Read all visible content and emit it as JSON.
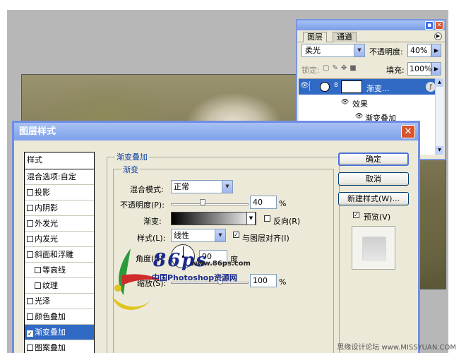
{
  "layers_panel": {
    "tabs": [
      "图层",
      "通道"
    ],
    "blend_mode": "柔光",
    "opacity_label": "不透明度:",
    "opacity_value": "40%",
    "lock_label": "锁定:",
    "fill_label": "填充:",
    "fill_value": "100%",
    "layer_name": "渐变...",
    "effects_label": "效果",
    "effect_item": "渐变叠加"
  },
  "dialog": {
    "title": "图层样式",
    "styles_header": "样式",
    "blend_options": "混合选项:自定",
    "style_items": [
      {
        "label": "投影",
        "checked": false,
        "indent": false,
        "selected": false
      },
      {
        "label": "内阴影",
        "checked": false,
        "indent": false,
        "selected": false
      },
      {
        "label": "外发光",
        "checked": false,
        "indent": false,
        "selected": false
      },
      {
        "label": "内发光",
        "checked": false,
        "indent": false,
        "selected": false
      },
      {
        "label": "斜面和浮雕",
        "checked": false,
        "indent": false,
        "selected": false
      },
      {
        "label": "等高线",
        "checked": false,
        "indent": true,
        "selected": false
      },
      {
        "label": "纹理",
        "checked": false,
        "indent": true,
        "selected": false
      },
      {
        "label": "光泽",
        "checked": false,
        "indent": false,
        "selected": false
      },
      {
        "label": "颜色叠加",
        "checked": false,
        "indent": false,
        "selected": false
      },
      {
        "label": "渐变叠加",
        "checked": true,
        "indent": false,
        "selected": true
      },
      {
        "label": "图案叠加",
        "checked": false,
        "indent": false,
        "selected": false
      }
    ],
    "section_title": "渐变叠加",
    "group_title": "渐变",
    "blend_mode_label": "混合模式:",
    "blend_mode_value": "正常",
    "opacity_label": "不透明度(P):",
    "opacity_value": "40",
    "opacity_slider": 0.4,
    "percent": "%",
    "gradient_label": "渐变:",
    "reverse_label": "反向(R)",
    "style_label": "样式(L):",
    "style_value": "线性",
    "align_label": "与图层对齐(I)",
    "angle_label": "角度(N):",
    "angle_value": "90",
    "degree": "度",
    "scale_label": "缩放(S):",
    "scale_value": "100",
    "scale_slider": 1.0,
    "ok_button": "确定",
    "cancel_button": "取消",
    "new_style_button": "新建样式(W)...",
    "preview_label": "预览(V)"
  },
  "watermark": {
    "logo_number": "86ps",
    "logo_url": "www.86ps.com",
    "logo_text": "中国Photoshop资源网",
    "footer": "思缘设计论坛 www.MISSYUAN.COM"
  },
  "colors": {
    "title_bar": "#7da0eb",
    "selection": "#316ac5",
    "dialog_bg": "#ece9d8",
    "close_button": "#d6552d"
  }
}
